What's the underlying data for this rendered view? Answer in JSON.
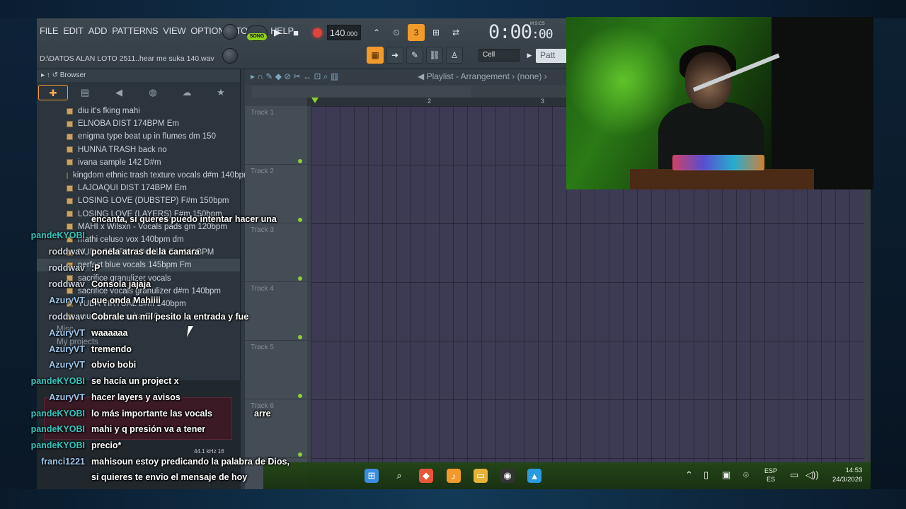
{
  "app": {
    "menu": [
      "FILE",
      "EDIT",
      "ADD",
      "PATTERNS",
      "VIEW",
      "OPTIONS",
      "TOOLS",
      "HELP"
    ],
    "song_mode": "SONG",
    "pat_mode": "PAT",
    "tempo_main": "140",
    "tempo_fraction": ".000",
    "time_main": "0:00",
    "time_sub": ":00",
    "time_format_label": "M:S:CS",
    "file_path": "D:\\DATOS ALAN LOTO 2511..hear me suka 140.wav",
    "snap_select": "Cell",
    "pattern_button": "Patt"
  },
  "browser": {
    "header": "Browser",
    "tab_icons": [
      "plus-icon",
      "file-icon",
      "speaker-icon",
      "globe-icon",
      "cloud-icon",
      "star-icon"
    ],
    "files": [
      "diu it's fking mahi",
      "ELNOBA DIST 174BPM Em",
      "enigma type beat up in flumes dm 150",
      "HUNNA TRASH back no",
      "ivana sample 142 D#m",
      "kingdom ethnic trash  texture vocals d#m 140bpm",
      "LAJOAQUI DIST 174BPM Em",
      "LOSING LOVE (DUBSTEP) F#m 150bpm",
      "LOSING LOVE (LAYERS) F#m 150bpm",
      "MAHI x Wilsxn - Vocals pads gm 120bpm",
      "mathi celuso vox 140bpm dm",
      "NUDA SPXRN VOCALS Em 140BPM",
      "perfect blue vocals 145bpm Fm",
      "sacrifice granulizer vocals",
      "sacrifice vocals granulizer d#m 140bpm",
      "YUDA VIRTUAL d#m 140bpm",
      "you hear me suka 140"
    ],
    "selected_index": 12,
    "sections": [
      "Misc",
      "My projects"
    ],
    "sample_info": "44.1 kHz 16"
  },
  "playlist": {
    "title": "Playlist - Arrangement",
    "pattern": "(none)",
    "ruler": [
      "2",
      "3"
    ],
    "tracks": [
      "Track 1",
      "Track 2",
      "Track 3",
      "Track 4",
      "Track 5",
      "Track 6"
    ]
  },
  "chat": [
    {
      "user": "",
      "color": "#ffffff",
      "text": "encanta, si queres puedo intentar hacer una"
    },
    {
      "user": "pandeKYOBI",
      "color": "#34c7c1",
      "text": ""
    },
    {
      "user": "roddwav",
      "color": "#c7d0d8",
      "text": "ponela atras de la camara"
    },
    {
      "user": "roddwav",
      "color": "#c7d0d8",
      "text": ":P"
    },
    {
      "user": "roddwav",
      "color": "#c7d0d8",
      "text": "Consola jajaja"
    },
    {
      "user": "AzuryVT",
      "color": "#9ec5e8",
      "text": "que onda Mahiiii"
    },
    {
      "user": "roddwav",
      "color": "#c7d0d8",
      "text": "Cobrale un mil pesito la entrada y fue"
    },
    {
      "user": "AzuryVT",
      "color": "#9ec5e8",
      "text": "waaaaaa"
    },
    {
      "user": "AzuryVT",
      "color": "#9ec5e8",
      "text": "tremendo"
    },
    {
      "user": "AzuryVT",
      "color": "#9ec5e8",
      "text": "obvio bobi"
    },
    {
      "user": "pandeKYOBI",
      "color": "#34c7c1",
      "text": "se hacía un project x"
    },
    {
      "user": "AzuryVT",
      "color": "#9ec5e8",
      "text": "hacer layers y avisos"
    },
    {
      "user": "pandeKYOBI",
      "color": "#34c7c1",
      "text": "lo más importante las vocals"
    },
    {
      "user": "",
      "color": "#ffffff",
      "text": "arre"
    },
    {
      "user": "pandeKYOBI",
      "color": "#34c7c1",
      "text": "mahi y q presión va a tener"
    },
    {
      "user": "pandeKYOBI",
      "color": "#34c7c1",
      "text": "precio*"
    },
    {
      "user": "franci1221",
      "color": "#9ec5e8",
      "text": "mahisoun estoy predicando la palabra de Dios,"
    },
    {
      "user": "",
      "color": "#ffffff",
      "text": "si quieres te envio el mensaje de hoy"
    }
  ],
  "taskbar": {
    "lang_top": "ESP",
    "lang_bottom": "ES",
    "time": "14:53",
    "date": "24/3/2026"
  },
  "colors": {
    "accent_orange": "#f29b2b",
    "accent_green": "#8bd32a",
    "record_red": "#e0433b",
    "chat_user_teal": "#34c7c1"
  }
}
